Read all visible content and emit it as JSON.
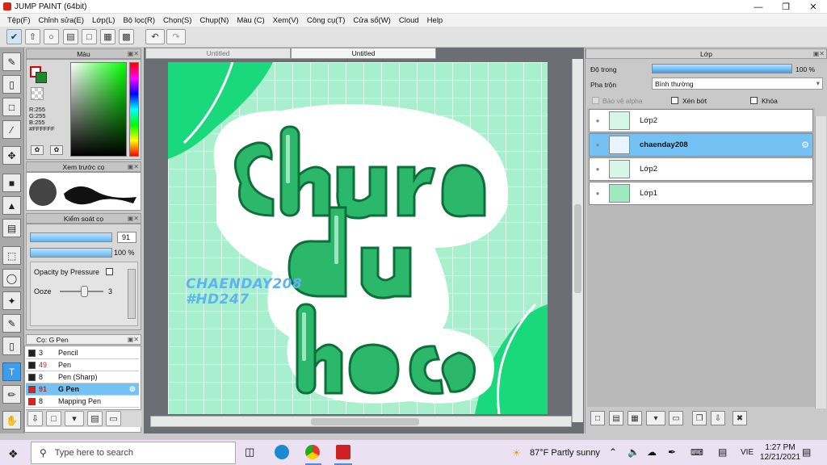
{
  "window": {
    "title": "JUMP PAINT (64bit)"
  },
  "menu": [
    "Tệp(F)",
    "Chỉnh sửa(E)",
    "Lớp(L)",
    "Bộ lọc(R)",
    "Chọn(S)",
    "Chụp(N)",
    "Màu (C)",
    "Xem(V)",
    "Công cụ(T)",
    "Cửa sổ(W)",
    "Cloud",
    "Help"
  ],
  "color_panel": {
    "title": "Màu",
    "r": "R:255",
    "g": "G:255",
    "b": "B:255",
    "hex": "#FFFFFF"
  },
  "preview_panel": {
    "title": "Xem trước cọ"
  },
  "control_panel": {
    "title": "Kiểm soát cọ",
    "size_value": "91",
    "opacity_value": "100 %",
    "pressure_label": "Opacity by Pressure",
    "ooze_label": "Ooze",
    "ooze_value": "3"
  },
  "brush_panel": {
    "title": "Cọ: G Pen",
    "brushes": [
      {
        "size": "3",
        "name": "Pencil",
        "color": "#222222"
      },
      {
        "size": "49",
        "name": "Pen",
        "color": "#222222"
      },
      {
        "size": "8",
        "name": "Pen (Sharp)",
        "color": "#222222"
      },
      {
        "size": "91",
        "name": "G Pen",
        "color": "#e02020"
      },
      {
        "size": "8",
        "name": "Mapping Pen",
        "color": "#e02020"
      }
    ]
  },
  "doc_tabs": [
    "Untitled",
    "Untitled"
  ],
  "canvas_text": {
    "line1": "CHAENDAY208",
    "line2": "#HD247",
    "lettering": "chưa du học"
  },
  "layer_panel": {
    "title": "Lớp",
    "opacity_label": "Độ trong",
    "opacity_value": "100 %",
    "blend_label": "Pha trộn",
    "blend_value": "Bình thường",
    "protect_alpha": "Bảo vệ alpha",
    "clipping": "Xén bớt",
    "lock": "Khóa",
    "layers": [
      {
        "name": "Lớp2",
        "selected": false
      },
      {
        "name": "chaenday208",
        "selected": true
      },
      {
        "name": "Lớp2",
        "selected": false
      },
      {
        "name": "Lớp1",
        "selected": false
      }
    ]
  },
  "taskbar": {
    "search_placeholder": "Type here to search",
    "weather": "87°F  Partly sunny",
    "lang": "VIE",
    "time": "1:27 PM",
    "date": "12/21/2021"
  },
  "colors": {
    "accent": "#74c2f3",
    "canvas_bg": "#a8f0cd",
    "letter_green": "#2cb86a"
  }
}
